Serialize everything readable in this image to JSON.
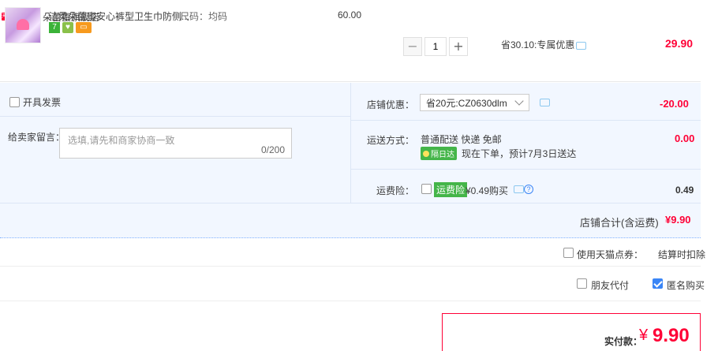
{
  "shop": {
    "tag": "天猫",
    "label": "店铺：朵蕾蜜旗舰店"
  },
  "item": {
    "title": "洁柔朵蕾蜜安心裤型卫生巾防侧...",
    "spec": "尺码：均码",
    "badge_icons": [
      "seven-day-return-icon",
      "insurance-icon",
      "credit-card-icon"
    ],
    "badge_7": "7",
    "unit_price": "60.00",
    "quantity": "1",
    "promo": "省30.10:专属优惠",
    "total": "29.90"
  },
  "extras": {
    "invoice_label": "开具发票",
    "message_label": "给卖家留言：",
    "message_placeholder": "选填,请先和商家协商一致",
    "message_count": "0/200",
    "coupon_label": "店铺优惠：",
    "coupon_value": "省20元:CZ0630dlm",
    "coupon_amount": "-20.00",
    "shipping_label": "运送方式：",
    "shipping_value": "普通配送 快递 免邮",
    "shipping_badge": "隔日达",
    "shipping_note": "现在下单，预计7月3日送达",
    "shipping_amount": "0.00",
    "insurance_label": "运费险：",
    "insurance_badge": "运费险",
    "insurance_price": "¥0.49购买",
    "insurance_amount": "0.49"
  },
  "shop_total": {
    "label": "店铺合计(含运费)",
    "value": "¥9.90"
  },
  "options": {
    "points_label": "使用天猫点券：",
    "points_note": "结算时扣除",
    "friend_pay_label": "朋友代付",
    "anonymous_label": "匿名购买",
    "anonymous_checked": true
  },
  "payment": {
    "label": "实付款：",
    "currency": "¥",
    "value": "9.90"
  },
  "colors": {
    "accent_red": "#ff0036",
    "panel_bg": "#f2f7ff",
    "check_blue": "#3a85f6",
    "badge_green": "#44b549"
  }
}
